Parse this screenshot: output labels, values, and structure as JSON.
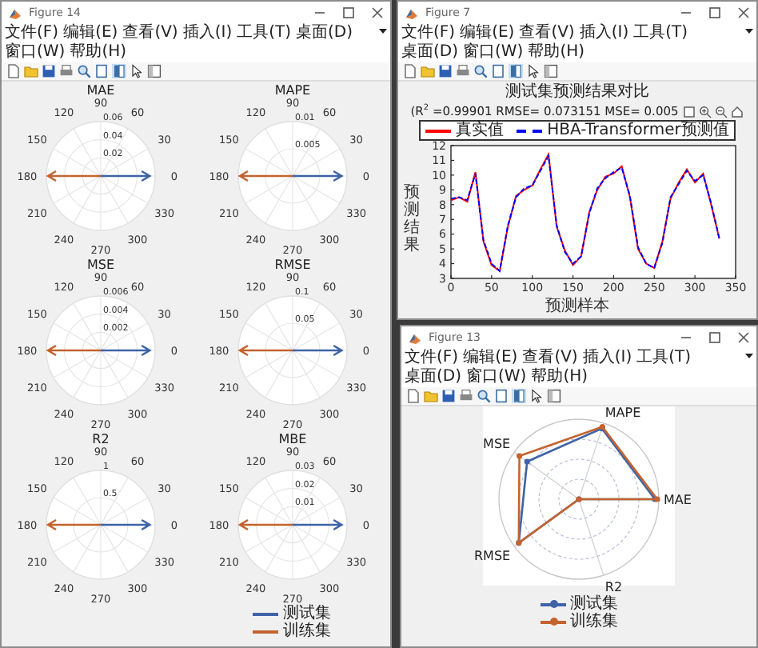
{
  "windows": [
    {
      "kind": "polar_grid",
      "title": "Figure 14",
      "menu": [
        "文件(F)",
        "编辑(E)",
        "查看(V)",
        "插入(I)",
        "工具(T)",
        "桌面(D)",
        "窗口(W)",
        "帮助(H)"
      ],
      "plots": [
        {
          "title": "MAE",
          "angle_labels": [
            "0",
            "30",
            "60",
            "90",
            "120",
            "150",
            "180",
            "210",
            "240",
            "270",
            "300",
            "330"
          ],
          "r_labels": [
            "0.06",
            "0.04",
            "0.02"
          ]
        },
        {
          "title": "MAPE",
          "angle_labels": [
            "0",
            "30",
            "60",
            "90",
            "120",
            "150",
            "180",
            "210",
            "240",
            "270",
            "300",
            "330"
          ],
          "r_labels": [
            "0.01",
            "0.005"
          ]
        },
        {
          "title": "MSE",
          "angle_labels": [
            "0",
            "30",
            "60",
            "90",
            "120",
            "150",
            "180",
            "210",
            "240",
            "270",
            "300",
            "330"
          ],
          "r_labels": [
            "0.006",
            "0.004",
            "0.002"
          ]
        },
        {
          "title": "RMSE",
          "angle_labels": [
            "0",
            "30",
            "60",
            "90",
            "120",
            "150",
            "180",
            "210",
            "240",
            "270",
            "300",
            "330"
          ],
          "r_labels": [
            "0.1",
            "0.05"
          ]
        },
        {
          "title": "R2",
          "angle_labels": [
            "0",
            "30",
            "60",
            "90",
            "120",
            "150",
            "180",
            "210",
            "240",
            "270",
            "300",
            "330"
          ],
          "r_labels": [
            "1",
            "0.5"
          ]
        },
        {
          "title": "MBE",
          "angle_labels": [
            "0",
            "30",
            "60",
            "90",
            "120",
            "150",
            "180",
            "210",
            "240",
            "270",
            "300",
            "330"
          ],
          "r_labels": [
            "0.03",
            "0.02",
            "0.01"
          ]
        }
      ],
      "legend": [
        {
          "label": "测试集",
          "color": "#3f63a6"
        },
        {
          "label": "训练集",
          "color": "#c4632f"
        }
      ]
    },
    {
      "kind": "line_chart",
      "title": "Figure 7",
      "menu": [
        "文件(F)",
        "编辑(E)",
        "查看(V)",
        "插入(I)",
        "工具(T)",
        "桌面(D)",
        "窗口(W)",
        "帮助(H)"
      ],
      "subtitle": "(R$^{2}$ =0.99901 RMSE= 0.073151 MSE= 0.005",
      "chart_data": {
        "type": "line",
        "title": "测试集预测结果对比",
        "xlabel": "预测样本",
        "ylabel": "预测结果",
        "x": [
          0,
          10,
          20,
          30,
          40,
          50,
          60,
          70,
          80,
          90,
          100,
          110,
          120,
          130,
          140,
          150,
          160,
          170,
          180,
          190,
          200,
          210,
          220,
          230,
          240,
          250,
          260,
          270,
          280,
          290,
          300,
          310,
          320,
          330
        ],
        "series": [
          {
            "name": "真实值",
            "color": "#ff0000",
            "line_style": "solid",
            "values": [
              8.3,
              8.5,
              8.2,
              10.2,
              5.5,
              3.9,
              3.5,
              6.5,
              8.6,
              9.0,
              9.3,
              10.4,
              11.4,
              6.5,
              4.9,
              3.9,
              4.5,
              7.5,
              9.0,
              9.9,
              10.1,
              10.6,
              8.5,
              5.0,
              4.0,
              3.7,
              5.5,
              8.4,
              9.5,
              10.4,
              9.5,
              10.1,
              8.0,
              5.7
            ]
          },
          {
            "name": "HBA-Transformer预测值",
            "color": "#0000ff",
            "line_style": "dashed",
            "values": [
              8.4,
              8.5,
              8.3,
              10.1,
              5.6,
              4.0,
              3.5,
              6.6,
              8.5,
              9.1,
              9.3,
              10.3,
              11.3,
              6.6,
              4.8,
              4.0,
              4.5,
              7.4,
              9.1,
              9.8,
              10.2,
              10.5,
              8.6,
              5.1,
              4.0,
              3.7,
              5.4,
              8.5,
              9.4,
              10.3,
              9.6,
              10.0,
              8.1,
              5.7
            ]
          }
        ],
        "xlim": [
          0,
          350
        ],
        "ylim": [
          3,
          12
        ],
        "xticks": [
          {
            "value": 0,
            "label": "0"
          },
          {
            "value": 50,
            "label": "50"
          },
          {
            "value": 100,
            "label": "100"
          },
          {
            "value": 150,
            "label": "150"
          },
          {
            "value": 200,
            "label": "200"
          },
          {
            "value": 250,
            "label": "250"
          },
          {
            "value": 300,
            "label": "300"
          },
          {
            "value": 350,
            "label": "350"
          }
        ],
        "yticks": [
          {
            "value": 3,
            "label": "3"
          },
          {
            "value": 4,
            "label": "4"
          },
          {
            "value": 5,
            "label": "5"
          },
          {
            "value": 6,
            "label": "6"
          },
          {
            "value": 7,
            "label": "7"
          },
          {
            "value": 8,
            "label": "8"
          },
          {
            "value": 9,
            "label": "9"
          },
          {
            "value": 10,
            "label": "10"
          },
          {
            "value": 11,
            "label": "11"
          },
          {
            "value": 12,
            "label": "12"
          }
        ]
      }
    },
    {
      "kind": "radar",
      "title": "Figure 13",
      "menu": [
        "文件(F)",
        "编辑(E)",
        "查看(V)",
        "插入(I)",
        "工具(T)",
        "桌面(D)",
        "窗口(W)",
        "帮助(H)"
      ],
      "axis_labels": [
        "MAE",
        "MAPE",
        "MSE",
        "RMSE",
        "R2"
      ],
      "legend": [
        {
          "label": "测试集",
          "color": "#3f63a6"
        },
        {
          "label": "训练集",
          "color": "#c4632f"
        }
      ]
    }
  ]
}
